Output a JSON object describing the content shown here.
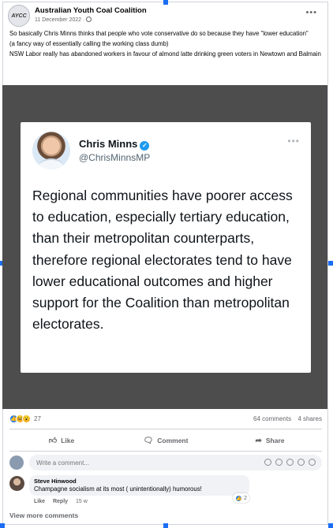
{
  "post": {
    "page_name": "Australian Youth Coal Coalition",
    "avatar_text": "AYCC",
    "date": "11 December 2022 ·",
    "more_icon": "more-horizontal-icon",
    "paragraphs": [
      "So basically Chris Minns thinks that people who vote conservative do so because they have \"lower education\"",
      "(a fancy way of essentially calling the working class dumb)",
      "NSW Labor really has abandoned workers in favour of almond latte drinking green voters in Newtown and Balmain"
    ]
  },
  "tweet": {
    "name": "Chris Minns",
    "handle": "@ChrisMinnsMP",
    "body": "Regional communities have poorer access to education, especially tertiary education, than their metropolitan counterparts, therefore regional electorates tend to have lower educational outcomes and higher support for the Coalition than metropolitan electorates."
  },
  "stats": {
    "reaction_count": "27",
    "comments": "64 comments",
    "shares": "4 shares"
  },
  "actions": {
    "like": "Like",
    "comment": "Comment",
    "share": "Share"
  },
  "write_comment": {
    "placeholder": "Write a comment..."
  },
  "comment": {
    "author": "Steve Hinwood",
    "text": "Champagne socialism at its most ( unintentionally) humorous!",
    "like_label": "Like",
    "reply_label": "Reply",
    "age": "15 w",
    "reaction_count": "2"
  },
  "view_more": "View more comments",
  "colors": {
    "accent": "#1877f2",
    "image_background": "#4d4d4d",
    "verified": "#1d9bf0"
  }
}
